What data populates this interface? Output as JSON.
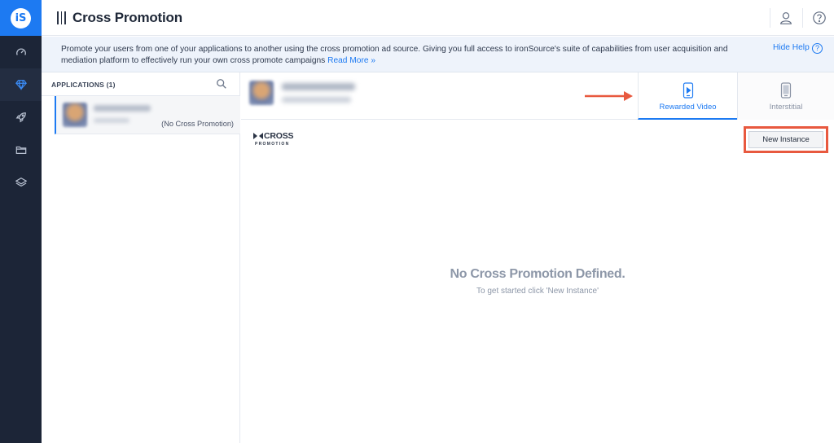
{
  "app": {
    "logo_text": "iS"
  },
  "nav": {
    "items": [
      {
        "icon": "gauge-icon"
      },
      {
        "icon": "diamond-icon",
        "active": true
      },
      {
        "icon": "rocket-icon"
      },
      {
        "icon": "folder-icon"
      },
      {
        "icon": "layers-icon"
      }
    ]
  },
  "header": {
    "title": "Cross Promotion",
    "icons": [
      "user-icon",
      "help-icon"
    ]
  },
  "help_banner": {
    "text": "Promote your users from one of your applications to another using the cross promotion ad source. Giving you full access to ironSource's suite of capabilities from user acquisition and mediation platform to effectively run your own cross promote campaigns",
    "link": "Read More »",
    "hide_label": "Hide Help",
    "help_glyph": "?"
  },
  "applications": {
    "header": "APPLICATIONS (1)",
    "items": [
      {
        "status": "(No Cross Promotion)"
      }
    ]
  },
  "tabs": [
    {
      "label": "Rewarded Video",
      "active": true,
      "icon": "video-phone-icon"
    },
    {
      "label": "Interstitial",
      "active": false,
      "icon": "phone-icon"
    }
  ],
  "brand": {
    "word": "CROSS",
    "sub": "PROMOTION"
  },
  "actions": {
    "new_instance": "New Instance"
  },
  "empty_state": {
    "title": "No Cross Promotion Defined.",
    "subtitle": "To get started click 'New Instance'"
  },
  "colors": {
    "accent": "#1d7af2",
    "rail": "#1c2537",
    "highlight": "#e8593f"
  }
}
